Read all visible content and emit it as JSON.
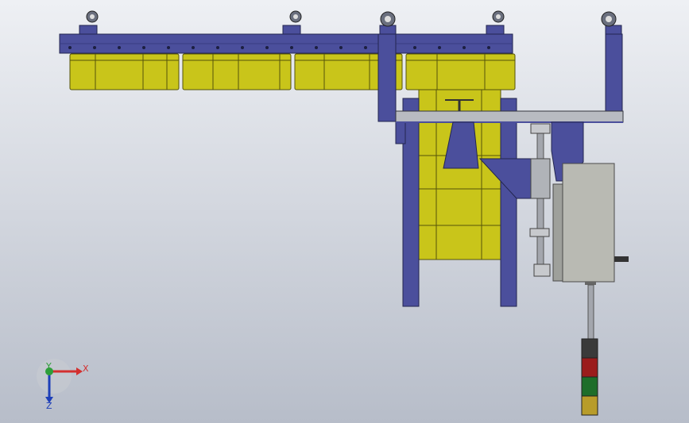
{
  "viewport": {
    "background_top": "#eef0f4",
    "background_bottom": "#b7bdc9"
  },
  "model": {
    "frame_color": "#4b4f9c",
    "frame_edge": "#23264f",
    "bin_color": "#c9c51a",
    "bin_edge": "#55530a",
    "cabinet_color": "#b9bab3",
    "steel_color": "#9da0a6",
    "tower_light_colors": [
      "#3a3a3a",
      "#9b1c1c",
      "#1e6e2a",
      "#b89c2a"
    ]
  },
  "triad": {
    "x_label": "X",
    "y_label": "Y",
    "z_label": "Z",
    "x_color": "#d32f2f",
    "y_color": "#2e9e3a",
    "z_color": "#1e3fb8"
  }
}
